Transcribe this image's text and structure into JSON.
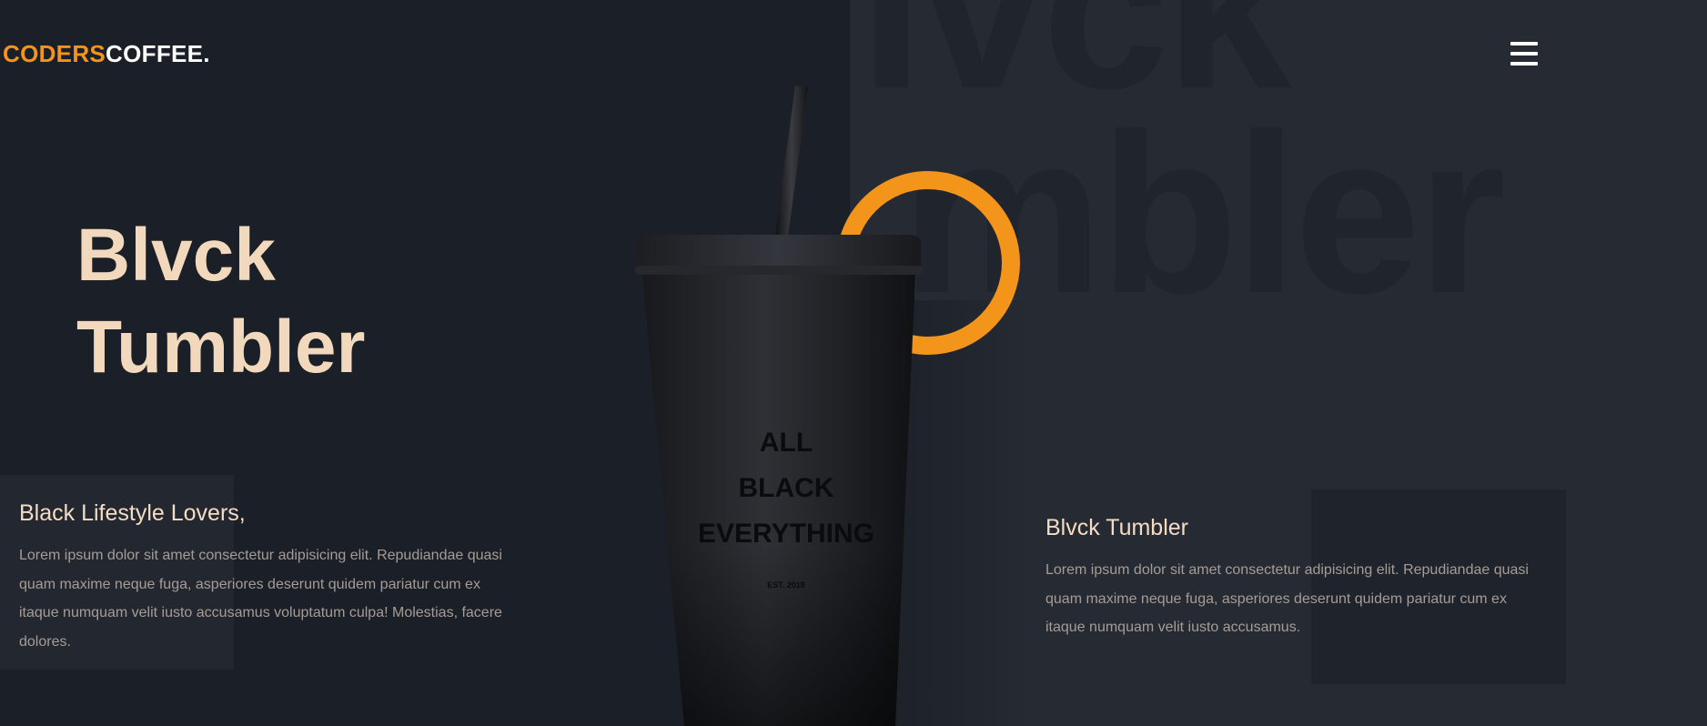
{
  "header": {
    "logo_part1": "CODERS",
    "logo_part2": "COFFEE.",
    "menu_icon": "hamburger-menu-icon"
  },
  "hero": {
    "title_line1": "Blvck",
    "title_line2": "Tumbler",
    "background_word_top": "Ivck",
    "background_word_bottom": "mbler"
  },
  "product": {
    "print_line1": "ALL",
    "print_line2": "BLACK",
    "print_line3": "EVERYTHING",
    "print_est": "EST. 2018"
  },
  "left_block": {
    "heading": "Black Lifestyle Lovers,",
    "text": "Lorem ipsum dolor sit amet consectetur adipisicing elit. Repudiandae quasi quam maxime neque fuga, asperiores deserunt quidem pariatur cum ex itaque numquam velit iusto accusamus voluptatum culpa! Molestias, facere dolores."
  },
  "right_block": {
    "heading": "Blvck Tumbler",
    "text": "Lorem ipsum dolor sit amet consectetur adipisicing elit. Repudiandae quasi quam maxime neque fuga, asperiores deserunt quidem pariatur cum ex itaque numquam velit iusto accusamus."
  },
  "colors": {
    "accent": "#f3941b",
    "headline": "#f2d9bd",
    "background_left": "#1b1f27",
    "background_right": "#252a33"
  }
}
